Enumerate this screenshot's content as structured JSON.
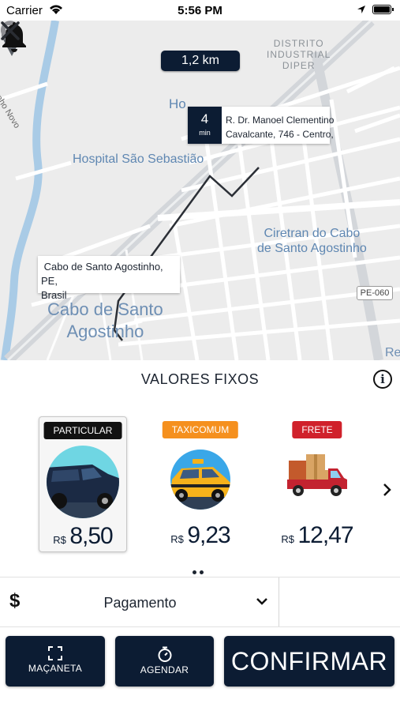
{
  "status_bar": {
    "carrier": "Carrier",
    "time": "5:56 PM"
  },
  "map": {
    "distance": "1,2 km",
    "labels": {
      "district": "DISTRITO\nINDUSTRIAL\nDIPER",
      "ho": "Ho",
      "hospital": "Hospital São Sebastião",
      "ciretran": "Ciretran do Cabo\nde Santo Agostinho",
      "city": "Cabo de Santo\nAgostinho",
      "road_left": "genho Novo",
      "highway": "PE-060",
      "re": "Re"
    },
    "eta": {
      "value": "4",
      "unit": "min"
    },
    "destination_address": "R. Dr. Manoel Clementino\nCavalcante, 746 - Centro,",
    "origin_address": "Cabo de Santo Agostinho, PE,\nBrasil"
  },
  "section_title": "VALORES FIXOS",
  "vehicles": [
    {
      "badge": "PARTICULAR",
      "badge_color": "#111111",
      "currency": "R$",
      "price": "8,50",
      "selected": true
    },
    {
      "badge": "TAXICOMUM",
      "badge_color": "#f5901e",
      "currency": "R$",
      "price": "9,23",
      "selected": false
    },
    {
      "badge": "FRETE",
      "badge_color": "#d0212b",
      "currency": "R$",
      "price": "12,47",
      "selected": false
    }
  ],
  "payment": {
    "currency_symbol": "$",
    "label": "Pagamento"
  },
  "actions": {
    "handle": "MAÇANETA",
    "schedule": "AGENDAR",
    "confirm": "CONFIRMAR"
  },
  "colors": {
    "primary": "#0c1c33",
    "map_bg": "#ececec",
    "river": "#a9cbe6",
    "label_blue": "#5f87b2"
  }
}
